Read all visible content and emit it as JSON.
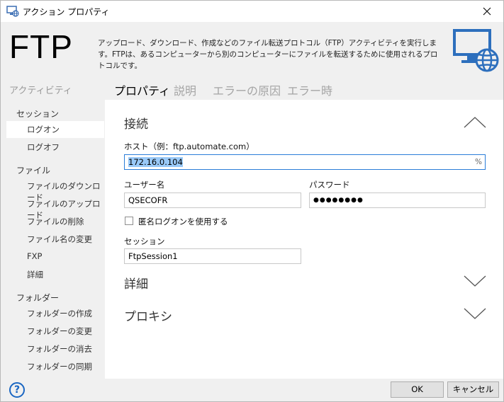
{
  "window": {
    "title": "アクション プロパティ"
  },
  "header": {
    "big_title": "FTP",
    "description": "アップロード、ダウンロード、作成などのファイル転送プロトコル（FTP）アクティビティを実行します。FTPは、あるコンピューターから別のコンピューターにファイルを転送するために使用されるプロトコルです。"
  },
  "sidebar": {
    "title": "アクティビティ",
    "groups": [
      {
        "label": "セッション",
        "items": [
          "ログオン",
          "ログオフ"
        ]
      },
      {
        "label": "ファイル",
        "items": [
          "ファイルのダウンロード",
          "ファイルのアップロード",
          "ファイルの削除",
          "ファイル名の変更",
          "FXP",
          "詳細"
        ]
      },
      {
        "label": "フォルダー",
        "items": [
          "フォルダーの作成",
          "フォルダーの変更",
          "フォルダーの消去",
          "フォルダーの同期"
        ]
      }
    ],
    "selected": "ログオン"
  },
  "tabs": [
    {
      "label": "プロパティ",
      "active": true
    },
    {
      "label": "説明",
      "active": false
    },
    {
      "label": "エラーの原因",
      "active": false
    },
    {
      "label": "エラー時",
      "active": false
    }
  ],
  "connection": {
    "section_title": "接続",
    "host_label": "ホスト（例：ftp.automate.com）",
    "host_value": "172.16.0.104",
    "host_suffix": "%",
    "user_label": "ユーザー名",
    "user_value": "QSECOFR",
    "password_label": "パスワード",
    "password_value": "●●●●●●●●",
    "anonymous_label": "匿名ログオンを使用する",
    "anonymous_checked": false,
    "session_label": "セッション",
    "session_value": "FtpSession1"
  },
  "sections": {
    "details": "詳細",
    "proxy": "プロキシ"
  },
  "footer": {
    "ok": "OK",
    "cancel": "キャンセル",
    "help": "?"
  },
  "colors": {
    "accent": "#2a7dd8",
    "icon_blue": "#2d6fbd",
    "help_blue": "#1a66c2",
    "selection": "#99c9f8"
  }
}
